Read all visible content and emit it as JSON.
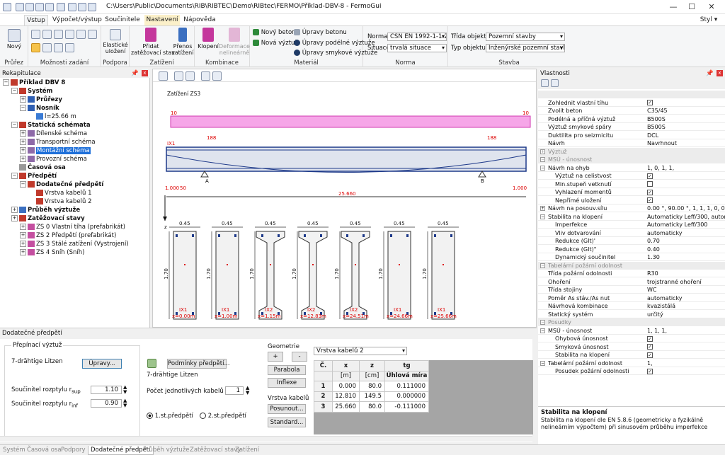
{
  "window": {
    "title": "C:\\Users\\Public\\Documents\\RIB\\RIBTEC\\Demo\\RIBtec\\FERMO\\Příklad-DBV-8 - FermoGui",
    "style_label": "Styl"
  },
  "tabs": [
    "Vstup",
    "Výpočet/výstup",
    "Součinitele",
    "Nastavení",
    "Nápověda"
  ],
  "ribbon": {
    "novy": "Nový",
    "prurez": "Průřez",
    "moznosti_zadani": "Možnosti zadání",
    "elasticke_ulozeni": "Elastické\nuložení",
    "podpora": "Podpora",
    "pridat_zatezovaci": "Přidat\nzatěžovací stav",
    "prenos_zatizeni": "Přenos\nzatížení",
    "zatizeni": "Zatížení",
    "kombinace_label": "Kombinace",
    "klopeni": "Klopení",
    "deformace": "Deformace\nnelineárně",
    "material_label": "Materiál",
    "novy_beton": "Nový beton",
    "nova_vyztuz": "Nová výztuž",
    "upravy_betonu": "Úpravy betonu",
    "upravy_podelne": "Úpravy podélné výztuže",
    "upravy_smykove": "Úpravy smykové výztuže",
    "norma_label": "Norma",
    "norma_value": "ČSN EN 1992-1-1:201",
    "situace_label": "Situace",
    "situace_value": "trvalá situace",
    "norma_group": "Norma",
    "trida_label": "Třída objektu",
    "trida_value": "Pozemní stavby",
    "typ_label": "Typ objektu",
    "typ_value": "Inženýrské pozemní stavby",
    "stavba_group": "Stavba"
  },
  "tree": {
    "header": "Rekapitulace",
    "items": [
      {
        "label": "Příklad DBV 8",
        "bold": true,
        "level": 0
      },
      {
        "label": "Systém",
        "bold": true,
        "level": 1
      },
      {
        "label": "Průřezy",
        "bold": true,
        "level": 2
      },
      {
        "label": "Nosník",
        "bold": true,
        "level": 2
      },
      {
        "label": "l=25.66 m",
        "bold": false,
        "level": 3
      },
      {
        "label": "Statická schémata",
        "bold": true,
        "level": 1
      },
      {
        "label": "Dílenské schéma",
        "bold": false,
        "level": 2
      },
      {
        "label": "Transportní schéma",
        "bold": false,
        "level": 2
      },
      {
        "label": "Montážní schéma",
        "bold": false,
        "level": 2,
        "selected": true
      },
      {
        "label": "Provozní schéma",
        "bold": false,
        "level": 2
      },
      {
        "label": "Časová osa",
        "bold": true,
        "level": 1
      },
      {
        "label": "Předpětí",
        "bold": true,
        "level": 1
      },
      {
        "label": "Dodatečné předpětí",
        "bold": true,
        "level": 2
      },
      {
        "label": "Vrstva kabelů 1",
        "bold": false,
        "level": 3
      },
      {
        "label": "Vrstva kabelů 2",
        "bold": false,
        "level": 3
      },
      {
        "label": "Průběh výztuže",
        "bold": true,
        "level": 1
      },
      {
        "label": "Zatěžovací stavy",
        "bold": true,
        "level": 1
      },
      {
        "label": "ZS 0 Vlastní tíha (prefabrikát)",
        "bold": false,
        "level": 2
      },
      {
        "label": "ZS 2 Předpětí (prefabrikát)",
        "bold": false,
        "level": 2
      },
      {
        "label": "ZS 3 Stálé zatížení (Vystrojení)",
        "bold": false,
        "level": 2
      },
      {
        "label": "ZS 4 Sníh (Sníh)",
        "bold": false,
        "level": 2
      }
    ]
  },
  "canvas": {
    "load_title": "Zatížení ZS3",
    "load_left": "10",
    "load_right": "10",
    "ix_label": "IX1",
    "pos_left": "188",
    "pos_right": "188",
    "support_a": "A",
    "support_b": "B",
    "dim_left": "1.000",
    "dim_left2": "50",
    "dim_right": "1.000",
    "span": "25.660",
    "z_label": "z",
    "sections": [
      {
        "w": "0.45",
        "h": "1.70",
        "name": "IX1",
        "x": "x=0.00m"
      },
      {
        "w": "0.45",
        "h": "1.70",
        "name": "IX1",
        "x": "x=1.00m"
      },
      {
        "w": "0.45",
        "h": "1.70",
        "name": "IX2",
        "x": "x=1.15m"
      },
      {
        "w": "0.45",
        "h": "1.70",
        "name": "IX2",
        "x": "x=12.83m"
      },
      {
        "w": "0.45",
        "h": "1.70",
        "name": "IX2",
        "x": "x=24.51m"
      },
      {
        "w": "0.45",
        "h": "1.70",
        "name": "IX1",
        "x": "x=24.66m"
      },
      {
        "w": "0.45",
        "h": "1.70",
        "name": "IX1",
        "x": "x=25.66m"
      }
    ]
  },
  "props": {
    "header": "Vlastnosti",
    "rows": [
      {
        "k": "",
        "v": "",
        "cat": true
      },
      {
        "k": "Zohlednit vlastní tíhu",
        "v": "",
        "chk": true
      },
      {
        "k": "Zvolit beton",
        "v": "C35/45"
      },
      {
        "k": "Podélná a příčná výztuž",
        "v": "B500S"
      },
      {
        "k": "Výztuž smykové spáry",
        "v": "B500S"
      },
      {
        "k": "Duktilita pro seizmicitu",
        "v": "DCL"
      },
      {
        "k": "Návrh",
        "v": "Navrhnout"
      },
      {
        "k": "Výztuž",
        "v": "",
        "cat": true
      },
      {
        "k": "MSÚ - únosnost",
        "v": "",
        "cat": true
      },
      {
        "k": "Návrh na ohyb",
        "v": "1, 0, 1, 1,"
      },
      {
        "k": "Výztuž na celistvost",
        "v": "",
        "chk": true
      },
      {
        "k": "Min.stupeň vetknutí",
        "v": "",
        "chk": false
      },
      {
        "k": "Vyhlazení momentů",
        "v": "",
        "chk": true
      },
      {
        "k": "Nepřímé uložení",
        "v": "",
        "chk": true
      },
      {
        "k": "Návrh na posouv.sílu",
        "v": "0.00 °, 90.00 °, 1, 1, 1, 0, 0, 1, 0, 0,"
      },
      {
        "k": "Stabilita na klopení",
        "v": "Automaticky Leff/300, automati..."
      },
      {
        "k": "Imperfekce",
        "v": "Automaticky Leff/300"
      },
      {
        "k": "Vliv dotvarování",
        "v": "automaticky"
      },
      {
        "k": "Redukce (GIt)'",
        "v": "0.70"
      },
      {
        "k": "Redukce (GIt)\"",
        "v": "0.40"
      },
      {
        "k": "Dynamický součinitel",
        "v": "1.30"
      },
      {
        "k": "Tabelární požární odolnost",
        "v": "",
        "cat": true
      },
      {
        "k": "Třída požární odolnosti",
        "v": "R30"
      },
      {
        "k": "Ohoření",
        "v": "trojstranné ohoření"
      },
      {
        "k": "Třída stojiny",
        "v": "WC"
      },
      {
        "k": "Poměr As stáv./As nut",
        "v": "automaticky"
      },
      {
        "k": "Návrhová kombinace",
        "v": "kvazistálá"
      },
      {
        "k": "Statický systém",
        "v": "určitý"
      },
      {
        "k": "Posudky",
        "v": "",
        "cat": true
      },
      {
        "k": "MSÚ - únosnost",
        "v": "1, 1, 1,"
      },
      {
        "k": "Ohybová únosnost",
        "v": "",
        "chk": true
      },
      {
        "k": "Smyková únosnost",
        "v": "",
        "chk": true
      },
      {
        "k": "Stabilita na klopení",
        "v": "",
        "chk": true
      },
      {
        "k": "Tabelární požární odolnost",
        "v": "1,"
      },
      {
        "k": "Posudek požární odolnosti",
        "v": "",
        "chk": true
      }
    ],
    "help_title": "Stabilita na klopení",
    "help_text": "Stabilita na klopení dle EN 5.8.6 (geometricky a fyzikálně nelineárním výpočtem) při sinusovém průběhu imperfekce"
  },
  "bottom": {
    "header": "Dodatečné předpětí",
    "prepinaci": "Přepínací výztuž",
    "litzen": "7-drähtige Litzen",
    "upravy": "Úpravy...",
    "soucinitel_sup": "Součinitel rozptylu r",
    "sup": "sup",
    "soucinitel_inf": "Součinitel rozptylu r",
    "inf": "inf",
    "val_sup": "1.10",
    "val_inf": "0.90",
    "litzen2": "7-drähtige Litzen",
    "podminky": "Podmínky předpětí...",
    "pocet_label": "Počet jednotlivých kabelů",
    "pocet_value": "1",
    "radio1": "1.st.předpětí",
    "radio2": "2.st.předpětí",
    "geometrie": "Geometrie",
    "plus": "+",
    "minus": "-",
    "parabola": "Parabola",
    "inflexe": "Inflexe",
    "vrstva_kabelu": "Vrstva kabelů",
    "posunout": "Posunout...",
    "standard": "Standard...",
    "layer_select": "Vrstva kabelů 2",
    "table_headers": [
      "Č.",
      "x",
      "z",
      "tg"
    ],
    "table_units": [
      "",
      "[m]",
      "[cm]",
      "Úhlová míra"
    ],
    "table_rows": [
      [
        "1",
        "0.000",
        "80.0",
        "0.111000"
      ],
      [
        "2",
        "12.810",
        "149.5",
        "0.000000"
      ],
      [
        "3",
        "25.660",
        "80.0",
        "-0.111000"
      ]
    ]
  },
  "statustabs": [
    "Systém",
    "Časová osa",
    "Podpory",
    "Dodatečné předpětí",
    "Průběh výztuže",
    "Zatěžovací stavy",
    "Zatížení"
  ]
}
